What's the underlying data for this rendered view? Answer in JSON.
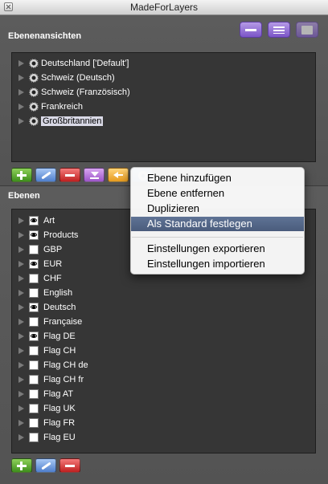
{
  "window": {
    "title": "MadeForLayers"
  },
  "views": {
    "title": "Ebenenansichten",
    "items": [
      {
        "label": "Deutschland ['Default']",
        "selected": false
      },
      {
        "label": "Schweiz (Deutsch)",
        "selected": false
      },
      {
        "label": "Schweiz (Französisch)",
        "selected": false
      },
      {
        "label": "Frankreich",
        "selected": false
      },
      {
        "label": "Großbritannien",
        "selected": true
      }
    ]
  },
  "layers": {
    "title": "Ebenen",
    "items": [
      {
        "label": "Art",
        "visible": true
      },
      {
        "label": "Products",
        "visible": true
      },
      {
        "label": "GBP",
        "visible": false
      },
      {
        "label": "EUR",
        "visible": true
      },
      {
        "label": "CHF",
        "visible": false
      },
      {
        "label": "English",
        "visible": false
      },
      {
        "label": "Deutsch",
        "visible": true
      },
      {
        "label": "Française",
        "visible": false
      },
      {
        "label": "Flag DE",
        "visible": true
      },
      {
        "label": "Flag CH",
        "visible": false
      },
      {
        "label": "Flag CH de",
        "visible": false
      },
      {
        "label": "Flag CH fr",
        "visible": false
      },
      {
        "label": "Flag AT",
        "visible": false
      },
      {
        "label": "Flag UK",
        "visible": false
      },
      {
        "label": "Flag FR",
        "visible": false
      },
      {
        "label": "Flag EU",
        "visible": false
      }
    ]
  },
  "context_menu": {
    "items": [
      {
        "label": "Ebene hinzufügen",
        "highlighted": false
      },
      {
        "label": "Ebene entfernen",
        "highlighted": false
      },
      {
        "label": "Duplizieren",
        "highlighted": false
      },
      {
        "label": "Als Standard festlegen",
        "highlighted": true
      },
      {
        "label": "Einstellungen exportieren",
        "highlighted": false
      },
      {
        "label": "Einstellungen importieren",
        "highlighted": false
      }
    ]
  },
  "colors": {
    "panel_bg": "#5a5a5a",
    "list_bg": "#363636",
    "accent_purple": "#7b55c8",
    "menu_highlight": "#5f7395"
  }
}
